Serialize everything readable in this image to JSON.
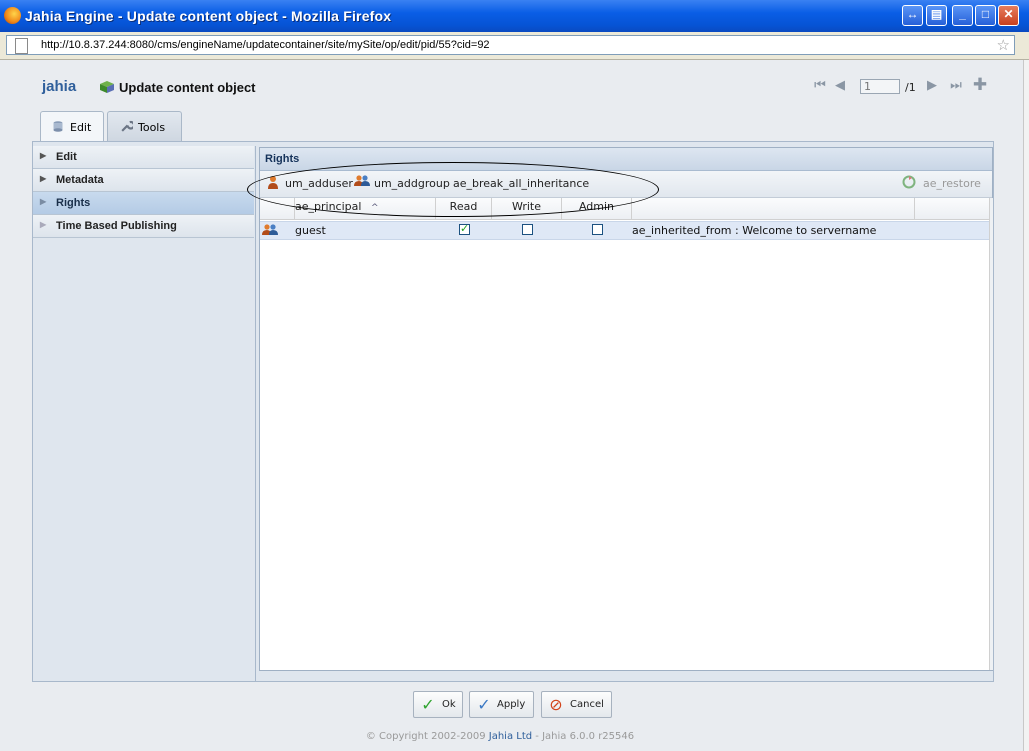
{
  "window": {
    "title": "Jahia Engine - Update content object - Mozilla Firefox",
    "url": "http://10.8.37.244:8080/cms/engineName/updatecontainer/site/mySite/op/edit/pid/55?cid=92"
  },
  "header": {
    "logo": "jahia",
    "title": "Update content object"
  },
  "pager": {
    "current_page": "1",
    "total": "/1"
  },
  "tabs": [
    {
      "label": "Edit",
      "active": true
    },
    {
      "label": "Tools",
      "active": false
    }
  ],
  "accordion": {
    "items": [
      {
        "label": "Edit",
        "active": false
      },
      {
        "label": "Metadata",
        "active": false
      },
      {
        "label": "Rights",
        "active": true
      },
      {
        "label": "Time Based Publishing",
        "active": false
      }
    ]
  },
  "rights_panel": {
    "title": "Rights",
    "toolbar": {
      "add_user": "um_adduser",
      "add_group": "um_addgroup",
      "break_inheritance": "ae_break_all_inheritance",
      "restore": "ae_restore"
    },
    "columns": [
      "ae_principal",
      "Read",
      "Write",
      "Admin"
    ],
    "rows": [
      {
        "principal": "guest",
        "read": true,
        "write": false,
        "admin": false,
        "inherited": "ae_inherited_from : Welcome to servername"
      }
    ]
  },
  "footer": {
    "ok": "Ok",
    "apply": "Apply",
    "cancel": "Cancel",
    "copyright_prefix": "© Copyright 2002-2009 ",
    "company": "Jahia Ltd",
    "version": " - Jahia 6.0.0 r25546"
  },
  "colors": {
    "titlebar": "#0a5ee6",
    "accent": "#2f5f9b",
    "selection": "#dfe8f6"
  }
}
